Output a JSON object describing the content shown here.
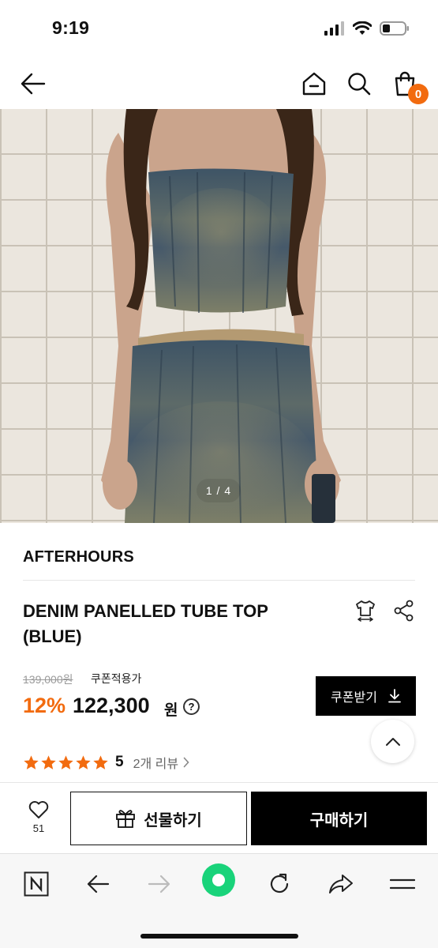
{
  "status": {
    "time": "9:19"
  },
  "nav": {
    "cart_count": "0"
  },
  "gallery": {
    "counter": "1 / 4"
  },
  "product": {
    "brand": "AFTERHOURS",
    "title": "DENIM PANELLED TUBE TOP (BLUE)",
    "original_price": "139,000원",
    "coupon_note": "쿠폰적용가",
    "discount": "12%",
    "price": "122,300",
    "currency": "원",
    "coupon_button": "쿠폰받기",
    "rating": "5",
    "review_link": "2개 리뷰"
  },
  "purchase_bar": {
    "like_count": "51",
    "gift_label": "선물하기",
    "buy_label": "구매하기"
  },
  "colors": {
    "accent": "#f26b0f",
    "star": "#f26b0f",
    "browser_home": "#19d37a"
  }
}
